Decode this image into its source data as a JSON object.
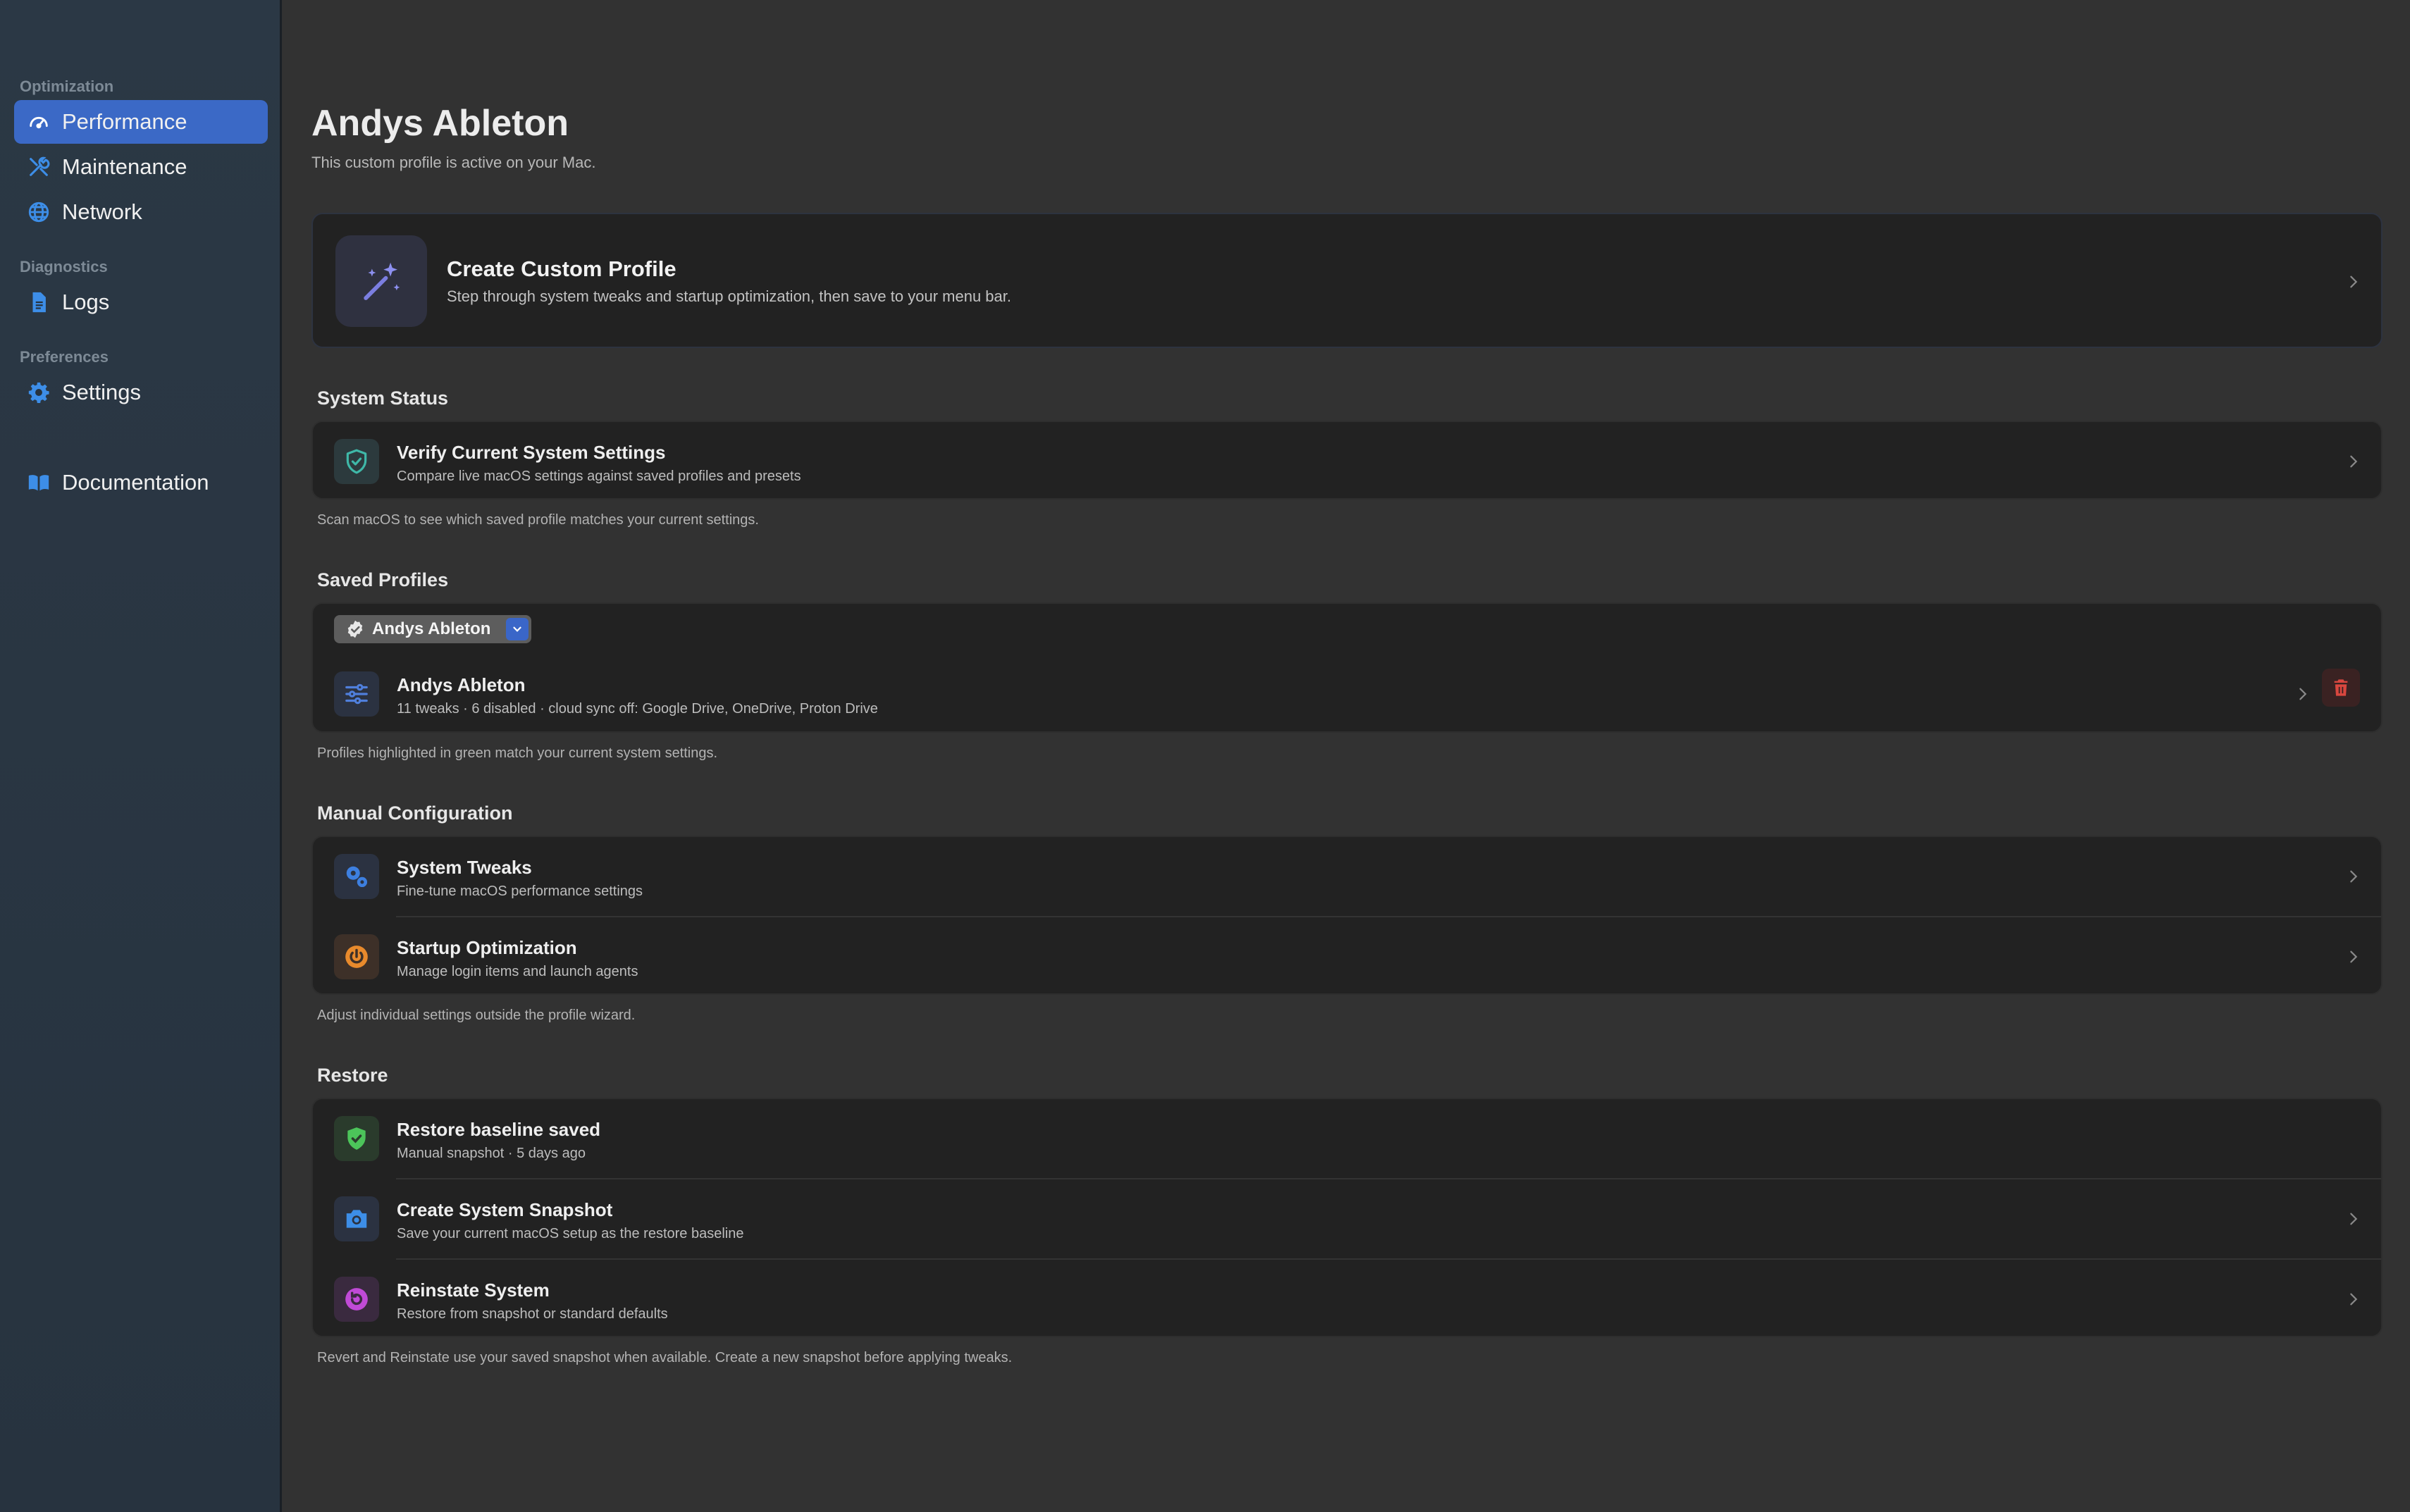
{
  "sidebar": {
    "sections": [
      {
        "label": "Optimization"
      },
      {
        "label": "Diagnostics"
      },
      {
        "label": "Preferences"
      }
    ],
    "items": [
      {
        "label": "Performance",
        "icon": "gauge-icon",
        "active": true
      },
      {
        "label": "Maintenance",
        "icon": "tools-icon"
      },
      {
        "label": "Network",
        "icon": "globe-icon"
      },
      {
        "label": "Logs",
        "icon": "document-icon"
      },
      {
        "label": "Settings",
        "icon": "gear-icon"
      },
      {
        "label": "Documentation",
        "icon": "book-icon"
      }
    ]
  },
  "header": {
    "title": "Andys Ableton",
    "subtitle": "This custom profile is active on your Mac."
  },
  "hero": {
    "title": "Create Custom Profile",
    "description": "Step through system tweaks and startup optimization, then save to your menu bar.",
    "icon": "magic-wand-icon"
  },
  "system_status": {
    "heading": "System Status",
    "row": {
      "title": "Verify Current System Settings",
      "subtitle": "Compare live macOS settings against saved profiles and presets",
      "icon": "shield-check-icon"
    },
    "footnote": "Scan macOS to see which saved profile matches your current settings."
  },
  "saved_profiles": {
    "heading": "Saved Profiles",
    "selected": "Andys Ableton",
    "row": {
      "title": "Andys Ableton",
      "subtitle": "11 tweaks · 6 disabled · cloud sync off: Google Drive, OneDrive, Proton Drive",
      "icon": "sliders-icon"
    },
    "footnote": "Profiles highlighted in green match your current system settings."
  },
  "manual_configuration": {
    "heading": "Manual Configuration",
    "rows": [
      {
        "title": "System Tweaks",
        "subtitle": "Fine-tune macOS performance settings",
        "icon": "gears-icon"
      },
      {
        "title": "Startup Optimization",
        "subtitle": "Manage login items and launch agents",
        "icon": "power-icon"
      }
    ],
    "footnote": "Adjust individual settings outside the profile wizard."
  },
  "restore": {
    "heading": "Restore",
    "rows": [
      {
        "title": "Restore baseline saved",
        "subtitle": "Manual snapshot · 5 days ago",
        "icon": "shield-check-green-icon"
      },
      {
        "title": "Create System Snapshot",
        "subtitle": "Save your current macOS setup as the restore baseline",
        "icon": "camera-icon"
      },
      {
        "title": "Reinstate System",
        "subtitle": "Restore from snapshot or standard defaults",
        "icon": "restore-icon"
      }
    ],
    "footnote": "Revert and Reinstate use your saved snapshot when available. Create a new snapshot before applying tweaks."
  },
  "colors": {
    "accent": "#3b69c6",
    "icon_blue": "#3d8ee8",
    "success": "#4cc45a",
    "danger": "#d9473f",
    "orange": "#e88a2c",
    "purple": "#c04ad6"
  }
}
